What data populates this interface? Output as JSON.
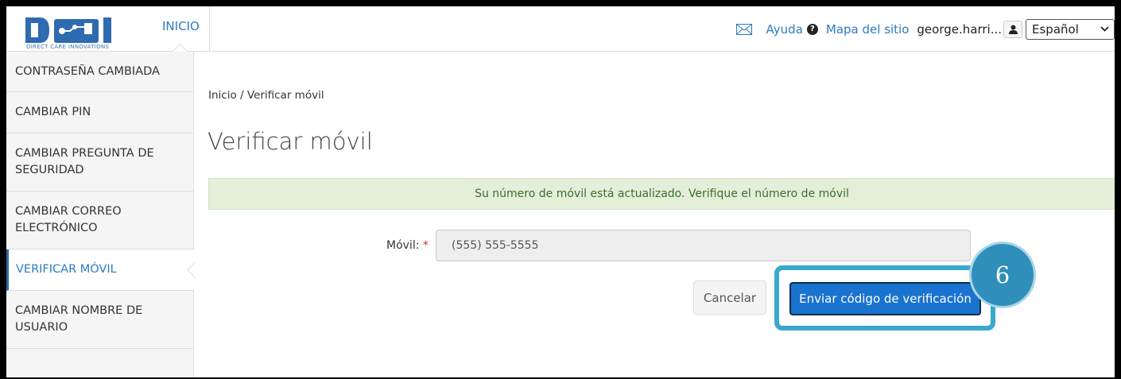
{
  "header": {
    "logo_text": "DCI",
    "logo_subtitle": "DIRECT CARE INNOVATIONS",
    "home_label": "INICIO",
    "help_label": "Ayuda",
    "sitemap_label": "Mapa del sitio",
    "username": "george.harri...",
    "language": "Español",
    "icons": {
      "mail": "mail-icon",
      "help": "question-circle-icon",
      "user": "user-icon",
      "select": "chevron-down-icon"
    }
  },
  "sidebar": {
    "items": [
      {
        "label": "CONTRASEÑA CAMBIADA"
      },
      {
        "label": "CAMBIAR PIN"
      },
      {
        "label": "CAMBIAR PREGUNTA DE SEGURIDAD"
      },
      {
        "label": "CAMBIAR CORREO ELECTRÓNICO"
      },
      {
        "label": "VERIFICAR MÓVIL",
        "active": true
      },
      {
        "label": "CAMBIAR NOMBRE DE USUARIO"
      }
    ]
  },
  "main": {
    "breadcrumb": "Inicio / Verificar móvil",
    "title": "Verificar móvil",
    "alert": "Su número de móvil está actualizado. Verifique el número de móvil",
    "mobile_label": "Móvil:",
    "required_marker": "*",
    "mobile_value": "(555) 555-5555",
    "cancel_label": "Cancelar",
    "send_label": "Enviar código de verificación"
  },
  "annotation": {
    "step": "6"
  },
  "colors": {
    "accent": "#2d7bc4",
    "primary_button": "#1a73cf",
    "alert_bg": "#e3efd8",
    "alert_text": "#3c6e2e",
    "highlight": "#3aa8cc",
    "badge": "#2f8fba"
  }
}
